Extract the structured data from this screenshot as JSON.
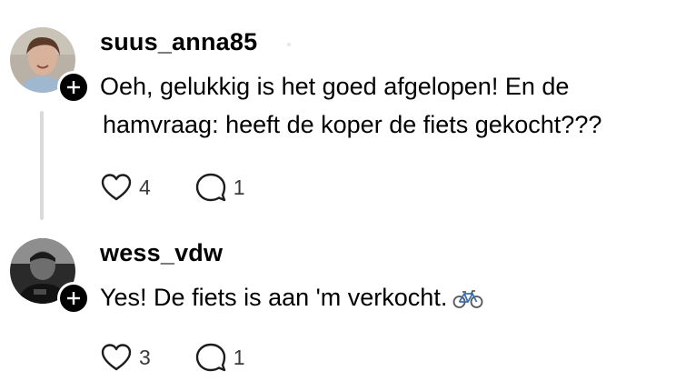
{
  "comments": [
    {
      "username": "suus_anna85",
      "text_line1": "Oeh, gelukkig is het goed afgelopen! En de",
      "text_line2": "hamvraag: heeft de koper de fiets gekocht???",
      "likes": "4",
      "replies": "1"
    },
    {
      "username": "wess_vdw",
      "text_line1": "Yes! De fiets is aan 'm verkocht.",
      "emoji": "bicycle-icon",
      "likes": "3",
      "replies": "1"
    }
  ]
}
